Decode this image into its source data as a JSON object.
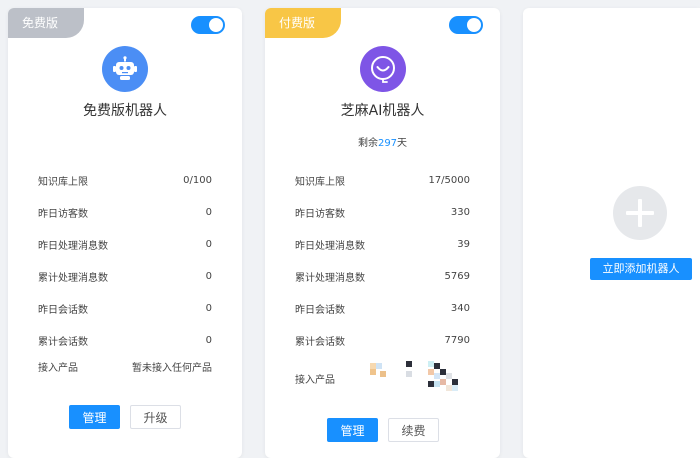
{
  "free_card": {
    "badge": "免费版",
    "name": "免费版机器人",
    "stats": [
      {
        "label": "知识库上限",
        "value": "0/100"
      },
      {
        "label": "昨日访客数",
        "value": "0"
      },
      {
        "label": "昨日处理消息数",
        "value": "0"
      },
      {
        "label": "累计处理消息数",
        "value": "0"
      },
      {
        "label": "昨日会话数",
        "value": "0"
      },
      {
        "label": "累计会话数",
        "value": "0"
      }
    ],
    "product_label": "接入产品",
    "product_value": "暂未接入任何产品",
    "manage_label": "管理",
    "second_label": "升级"
  },
  "paid_card": {
    "badge": "付费版",
    "name": "芝麻AI机器人",
    "remaining_prefix": "剩余",
    "remaining_days": "297",
    "remaining_suffix": "天",
    "stats": [
      {
        "label": "知识库上限",
        "value": "17/5000"
      },
      {
        "label": "昨日访客数",
        "value": "330"
      },
      {
        "label": "昨日处理消息数",
        "value": "39"
      },
      {
        "label": "累计处理消息数",
        "value": "5769"
      },
      {
        "label": "昨日会话数",
        "value": "340"
      },
      {
        "label": "累计会话数",
        "value": "7790"
      }
    ],
    "product_label": "接入产品",
    "manage_label": "管理",
    "second_label": "续费"
  },
  "add_card": {
    "button_label": "立即添加机器人"
  },
  "colors": {
    "accent": "#1890ff",
    "free_badge": "#bcc0c8",
    "paid_badge": "#f8c646",
    "free_avatar": "#4b8ef5",
    "paid_avatar": "#7e55e6"
  },
  "icons": {
    "free_avatar": "robot-icon",
    "paid_avatar": "smiley-headset-icon",
    "add": "plus-icon"
  }
}
